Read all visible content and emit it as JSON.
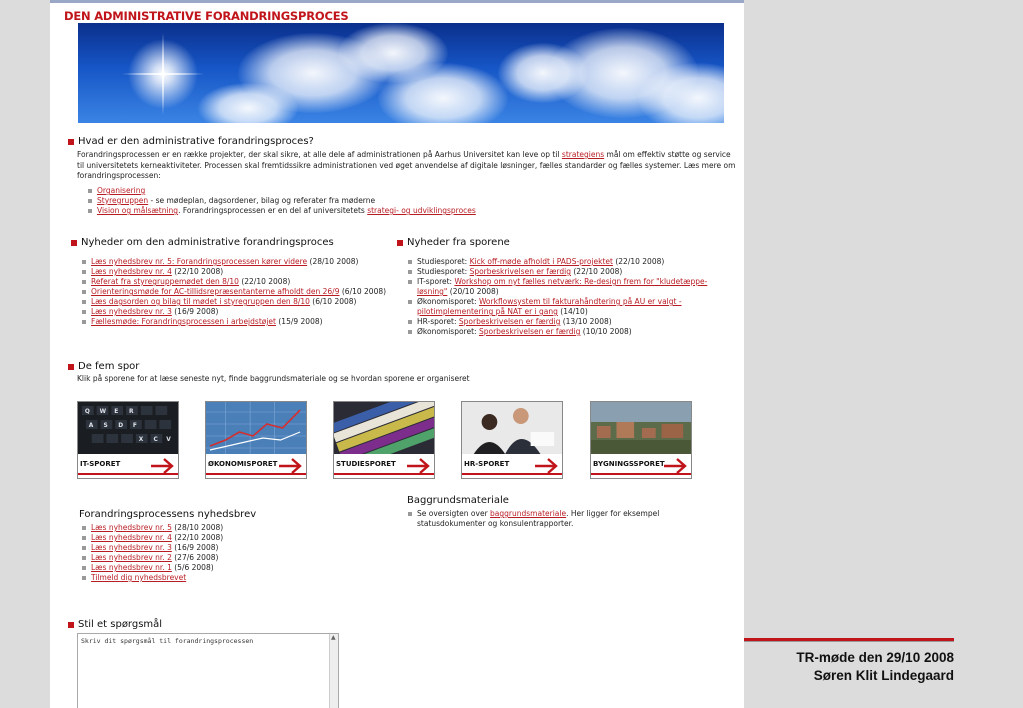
{
  "page": {
    "title": "DEN ADMINISTRATIVE FORANDRINGSPROCES"
  },
  "left_marker": "◂",
  "intro": {
    "heading": "Hvad er den administrative forandringsproces?",
    "text_a": "Forandringsprocessen er en række projekter, der skal sikre, at alle dele af administrationen på Aarhus Universitet kan leve op til ",
    "link_strategi": "strategiens",
    "text_b": " mål om effektiv støtte og service til universitetets kerneaktiviteter. Processen skal fremtidssikre administrationen ved øget anvendelse af digitale løsninger, fælles standarder og fælles systemer. Læs mere om forandringsprocessen:",
    "items": [
      {
        "link": "Organisering",
        "text": ""
      },
      {
        "link": "Styregruppen",
        "text": " - se mødeplan, dagsordener, bilag og referater fra møderne"
      },
      {
        "link": "Vision og målsætning",
        "text": ". Forandringsprocessen er en del af universitetets ",
        "link2": "strategi- og udviklingsproces"
      }
    ]
  },
  "news_admin": {
    "heading": "Nyheder om den administrative forandringsproces",
    "items": [
      {
        "link": "Læs nyhedsbrev nr. 5: Forandringsprocessen kører videre",
        "text": " (28/10 2008)"
      },
      {
        "link": "Læs nyhedsbrev nr. 4",
        "text": " (22/10 2008)"
      },
      {
        "link": "Referat fra styregruppemødet den 8/10",
        "text": " (22/10 2008)"
      },
      {
        "link": "Orienteringsmøde for AC-tillidsrepræsentanterne afholdt den 26/9",
        "text": " (6/10 2008)"
      },
      {
        "link": "Læs dagsorden og bilag til mødet i styregruppen den 8/10",
        "text": " (6/10 2008)"
      },
      {
        "link": "Læs nyhedsbrev nr. 3",
        "text": " (16/9 2008)"
      },
      {
        "link": "Fællesmøde: Forandringsprocessen i arbejdstøjet",
        "text": " (15/9 2008)"
      }
    ]
  },
  "news_spor": {
    "heading": "Nyheder fra sporene",
    "items": [
      {
        "prefix": "Studiesporet: ",
        "link": "Kick off-møde afholdt i PADS-projektet",
        "text": " (22/10 2008)"
      },
      {
        "prefix": "Studiesporet: ",
        "link": "Sporbeskrivelsen er færdig",
        "text": " (22/10 2008)"
      },
      {
        "prefix": "IT-sporet: ",
        "link": "Workshop om nyt fælles netværk: Re-design frem for \"kludetæppe-løsning\"",
        "text": " (20/10 2008)"
      },
      {
        "prefix": "Økonomisporet: ",
        "link": "Workflowsystem til fakturahåndtering på AU er valgt - pilotimplementering på NAT er i gang",
        "text": " (14/10)"
      },
      {
        "prefix": "HR-sporet: ",
        "link": "Sporbeskrivelsen er færdig",
        "text": " (13/10 2008)"
      },
      {
        "prefix": "Økonomisporet: ",
        "link": "Sporbeskrivelsen er færdig",
        "text": " (10/10 2008)"
      }
    ]
  },
  "spor": {
    "heading": "De fem spor",
    "subtitle": "Klik på sporene for at læse seneste nyt, finde baggrundsmateriale og se hvordan sporene er organiseret",
    "tiles": [
      {
        "label": "IT-SPORET"
      },
      {
        "label": "ØKONOMISPORET"
      },
      {
        "label": "STUDIESPORET"
      },
      {
        "label": "HR-SPORET"
      },
      {
        "label": "BYGNINGSSPORET"
      }
    ]
  },
  "newsletter": {
    "heading": "Forandringsprocessens nyhedsbrev",
    "items": [
      {
        "link": "Læs nyhedsbrev nr. 5",
        "text": " (28/10 2008)"
      },
      {
        "link": "Læs nyhedsbrev nr. 4",
        "text": " (22/10 2008)"
      },
      {
        "link": "Læs nyhedsbrev nr. 3",
        "text": " (16/9 2008)"
      },
      {
        "link": "Læs nyhedsbrev nr. 2",
        "text": " (27/6 2008)"
      },
      {
        "link": "Læs nyhedsbrev nr. 1",
        "text": " (5/6 2008)"
      },
      {
        "link": "Tilmeld dig nyhedsbrevet",
        "text": ""
      }
    ]
  },
  "background": {
    "heading": "Baggrundsmateriale",
    "text_a": "Se oversigten over ",
    "link": "baggrundsmateriale",
    "text_b": ". Her ligger for eksempel statusdokumenter og konsulentrapporter."
  },
  "question": {
    "heading": "Stil et spørgsmål",
    "placeholder": "Skriv dit spørgsmål til forandringsprocessen"
  },
  "footer": {
    "line1": "TR-møde  den 29/10 2008",
    "line2": "Søren Klit Lindegaard"
  },
  "colors": {
    "accent": "#c0141a",
    "link": "#b81d24"
  }
}
